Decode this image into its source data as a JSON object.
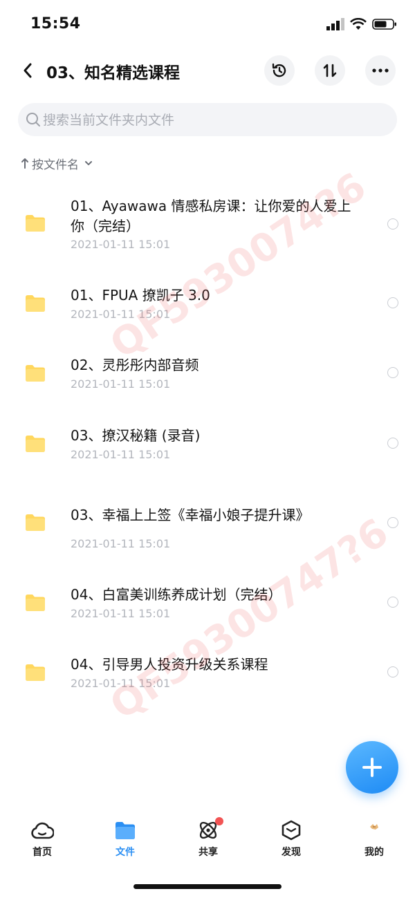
{
  "status_bar": {
    "time": "15:54"
  },
  "header": {
    "title": "03、知名精选课程"
  },
  "search": {
    "placeholder": "搜索当前文件夹内文件"
  },
  "sort": {
    "label": "按文件名"
  },
  "files": [
    {
      "name": "01、Ayawawa 情感私房课：让你爱的人爱上你（完结）",
      "date": "2021-01-11 15:01"
    },
    {
      "name": "01、FPUA 撩凯子 3.0",
      "date": "2021-01-11 15:01"
    },
    {
      "name": "02、灵彤彤内部音频",
      "date": "2021-01-11 15:01"
    },
    {
      "name": "03、撩汉秘籍 (录音)",
      "date": "2021-01-11 15:01"
    },
    {
      "name": "03、幸福上上签《幸福小娘子提升课》",
      "date": "2021-01-11 15:01"
    },
    {
      "name": "04、白富美训练养成计划（完结）",
      "date": "2021-01-11 15:01"
    },
    {
      "name": "04、引导男人投资升级关系课程",
      "date": "2021-01-11 15:01"
    }
  ],
  "watermarks": [
    "QF5930074?6",
    "QF59300747?6"
  ],
  "tabs": [
    {
      "label": "首页",
      "icon": "cloud-home-icon"
    },
    {
      "label": "文件",
      "icon": "folder-tab-icon"
    },
    {
      "label": "共享",
      "icon": "atom-share-icon"
    },
    {
      "label": "发现",
      "icon": "cube-discover-icon"
    },
    {
      "label": "我的",
      "icon": "avatar-icon"
    }
  ],
  "colors": {
    "accent": "#2b8ff3",
    "folder": "#ffd75e",
    "badge": "#f25454"
  }
}
